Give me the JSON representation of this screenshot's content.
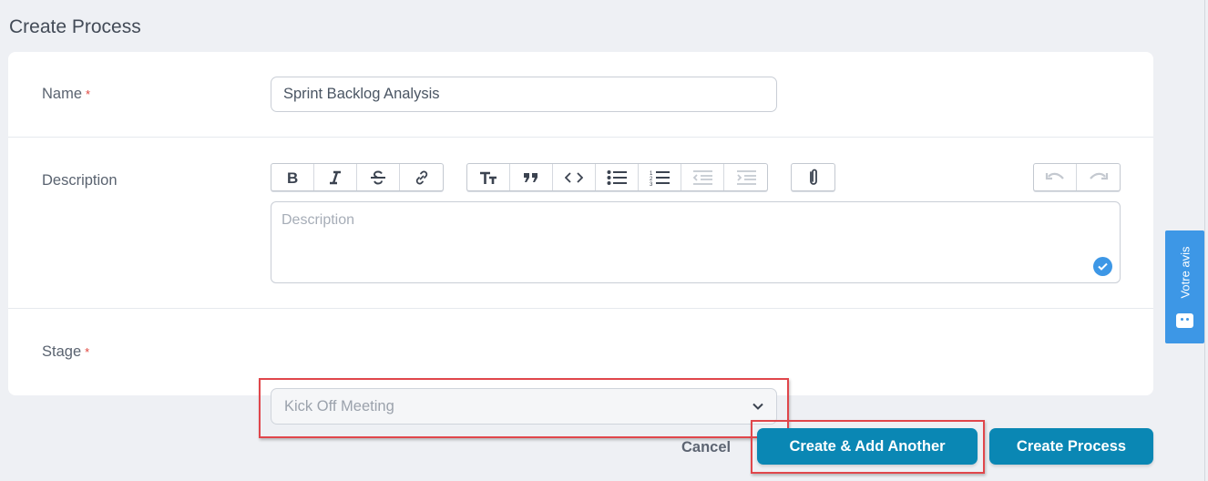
{
  "page": {
    "title": "Create Process"
  },
  "form": {
    "name": {
      "label": "Name",
      "required_mark": "*",
      "value": "Sprint Backlog Analysis"
    },
    "description": {
      "label": "Description",
      "placeholder": "Description",
      "toolbar": {
        "group1": [
          "bold-icon",
          "italic-icon",
          "strikethrough-icon",
          "link-icon"
        ],
        "group2": [
          "heading-icon",
          "quote-icon",
          "code-icon",
          "bullet-list-icon",
          "numbered-list-icon",
          "outdent-icon",
          "indent-icon"
        ],
        "group3": [
          "attachment-icon"
        ],
        "group4": [
          "undo-icon",
          "redo-icon"
        ],
        "disabled": [
          "outdent-icon",
          "indent-icon",
          "undo-icon",
          "redo-icon"
        ]
      }
    },
    "stage": {
      "label": "Stage",
      "required_mark": "*",
      "value": "Kick Off Meeting"
    }
  },
  "actions": {
    "cancel": "Cancel",
    "create_add_another": "Create & Add Another",
    "create": "Create Process"
  },
  "feedback": {
    "label": "Votre avis"
  },
  "colors": {
    "primary": "#0a87b4",
    "highlight": "#e0464b",
    "feedback": "#3d97e6",
    "required": "#e0443c"
  }
}
